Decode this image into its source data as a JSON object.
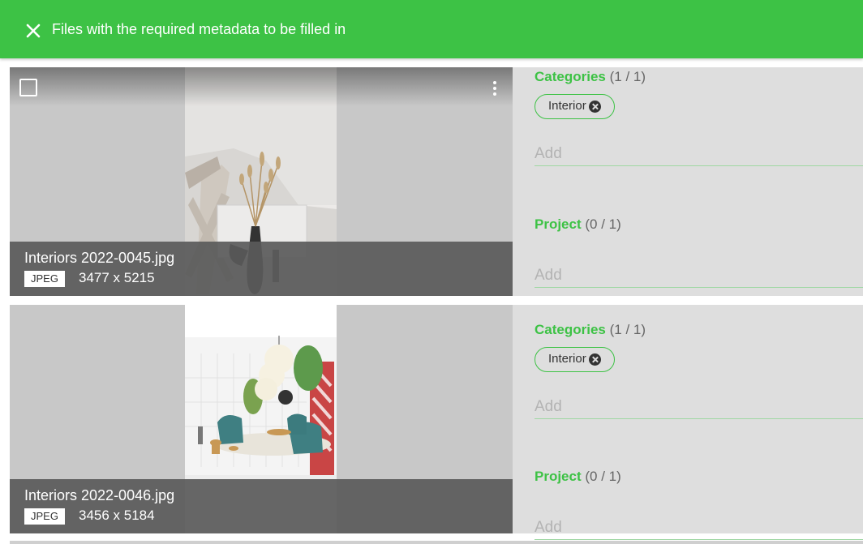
{
  "header": {
    "title": "Files with the required metadata to be filled in",
    "accent_color": "#3dc245",
    "close_icon": "close-icon"
  },
  "files": [
    {
      "filename": "Interiors 2022-0045.jpg",
      "format": "JPEG",
      "dimensions": "3477 x 5215",
      "categories_label": "Categories",
      "categories_count": "(1 / 1)",
      "category_chip": "Interior",
      "categories_placeholder": "Add",
      "project_label": "Project",
      "project_count": "(0 / 1)",
      "project_placeholder": "Add"
    },
    {
      "filename": "Interiors 2022-0046.jpg",
      "format": "JPEG",
      "dimensions": "3456 x 5184",
      "categories_label": "Categories",
      "categories_count": "(1 / 1)",
      "category_chip": "Interior",
      "categories_placeholder": "Add",
      "project_label": "Project",
      "project_count": "(0 / 1)",
      "project_placeholder": "Add"
    }
  ]
}
